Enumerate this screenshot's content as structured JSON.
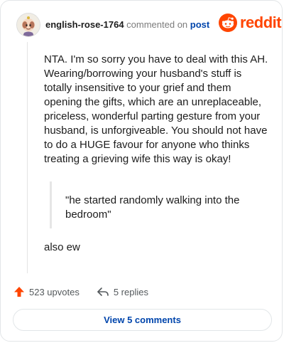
{
  "header": {
    "username": "english-rose-1764",
    "action_text": "commented on",
    "post_link": "post",
    "brand": "reddit"
  },
  "comment": {
    "body": "NTA. I'm so sorry you have to deal with this AH. Wearing/borrowing your husband's stuff is totally insensitive to your grief and them opening the gifts, which are an unreplaceable, priceless, wonderful parting gesture from your husband, is unforgiveable. You should not have to do a HUGE favour for anyone who thinks treating a grieving wife this way is okay!",
    "quote": "\"he started randomly walking into the bedroom\"",
    "tail": "also ew"
  },
  "footer": {
    "upvotes": "523 upvotes",
    "replies": "5 replies",
    "view_button": "View 5 comments"
  },
  "icons": {
    "avatar": "avatar-icon",
    "brand_logo": "reddit-logo-icon",
    "upvote": "upvote-arrow-icon",
    "reply": "reply-arrow-icon"
  },
  "colors": {
    "brand": "#ff4500",
    "link": "#0045ac",
    "text": "#1c1c1c",
    "muted": "#7c7c7c",
    "border": "#e3e6e8"
  }
}
